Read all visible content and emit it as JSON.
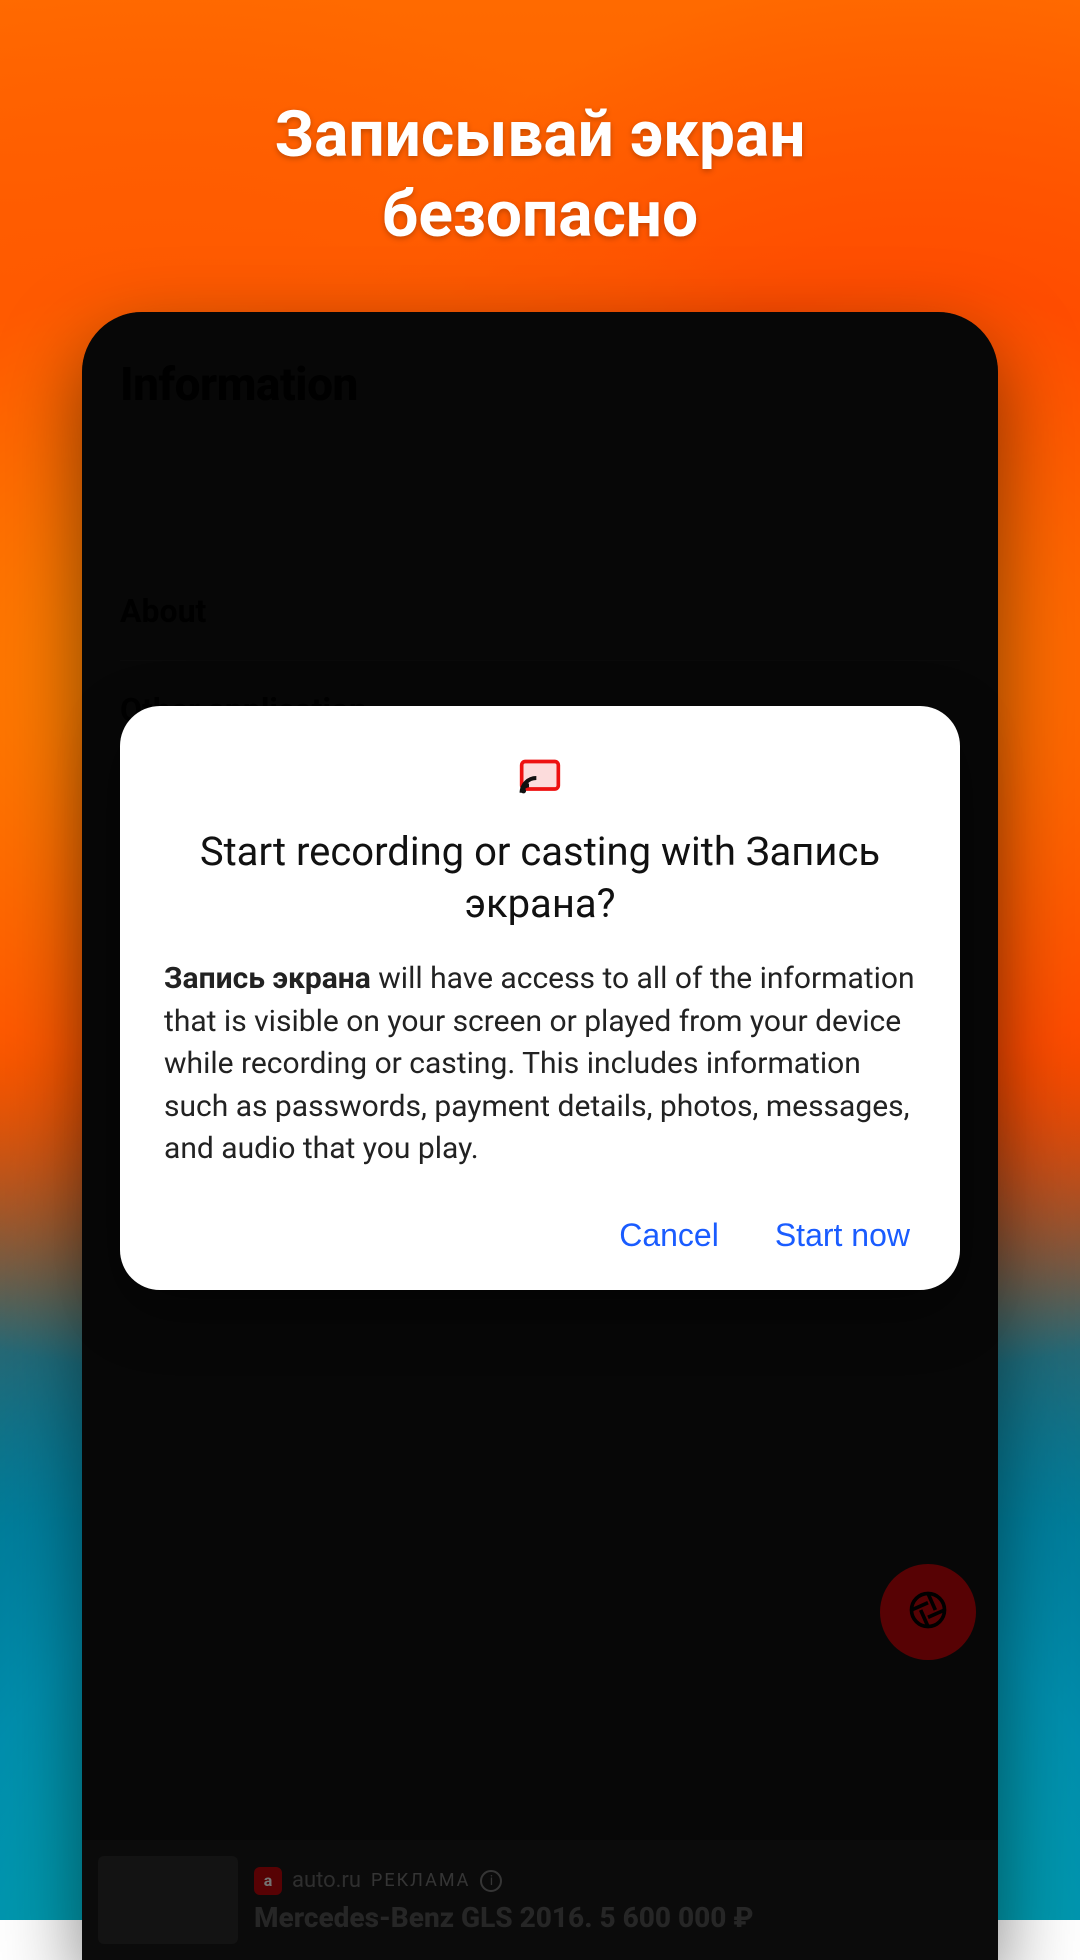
{
  "promo": {
    "headline_line1": "Записывай экран",
    "headline_line2": "безопасно"
  },
  "screen": {
    "page_title": "Information",
    "menu": {
      "about": "About",
      "other_app": "Other application"
    },
    "fab_icon": "camera-shutter-icon"
  },
  "ad": {
    "source": "auto.ru",
    "label": "РЕКЛАМА",
    "title": "Mercedes-Benz GLS 2016. 5 600 000 ₽"
  },
  "dialog": {
    "title": "Start recording or casting with Запись экрана?",
    "app_name": "Запись экрана",
    "body_rest": " will have access to all of the information that is visible on your screen or played from your device while recording or casting. This includes information such as passwords, payment details, photos, messages, and audio that you play.",
    "cancel": "Cancel",
    "start": "Start now"
  }
}
